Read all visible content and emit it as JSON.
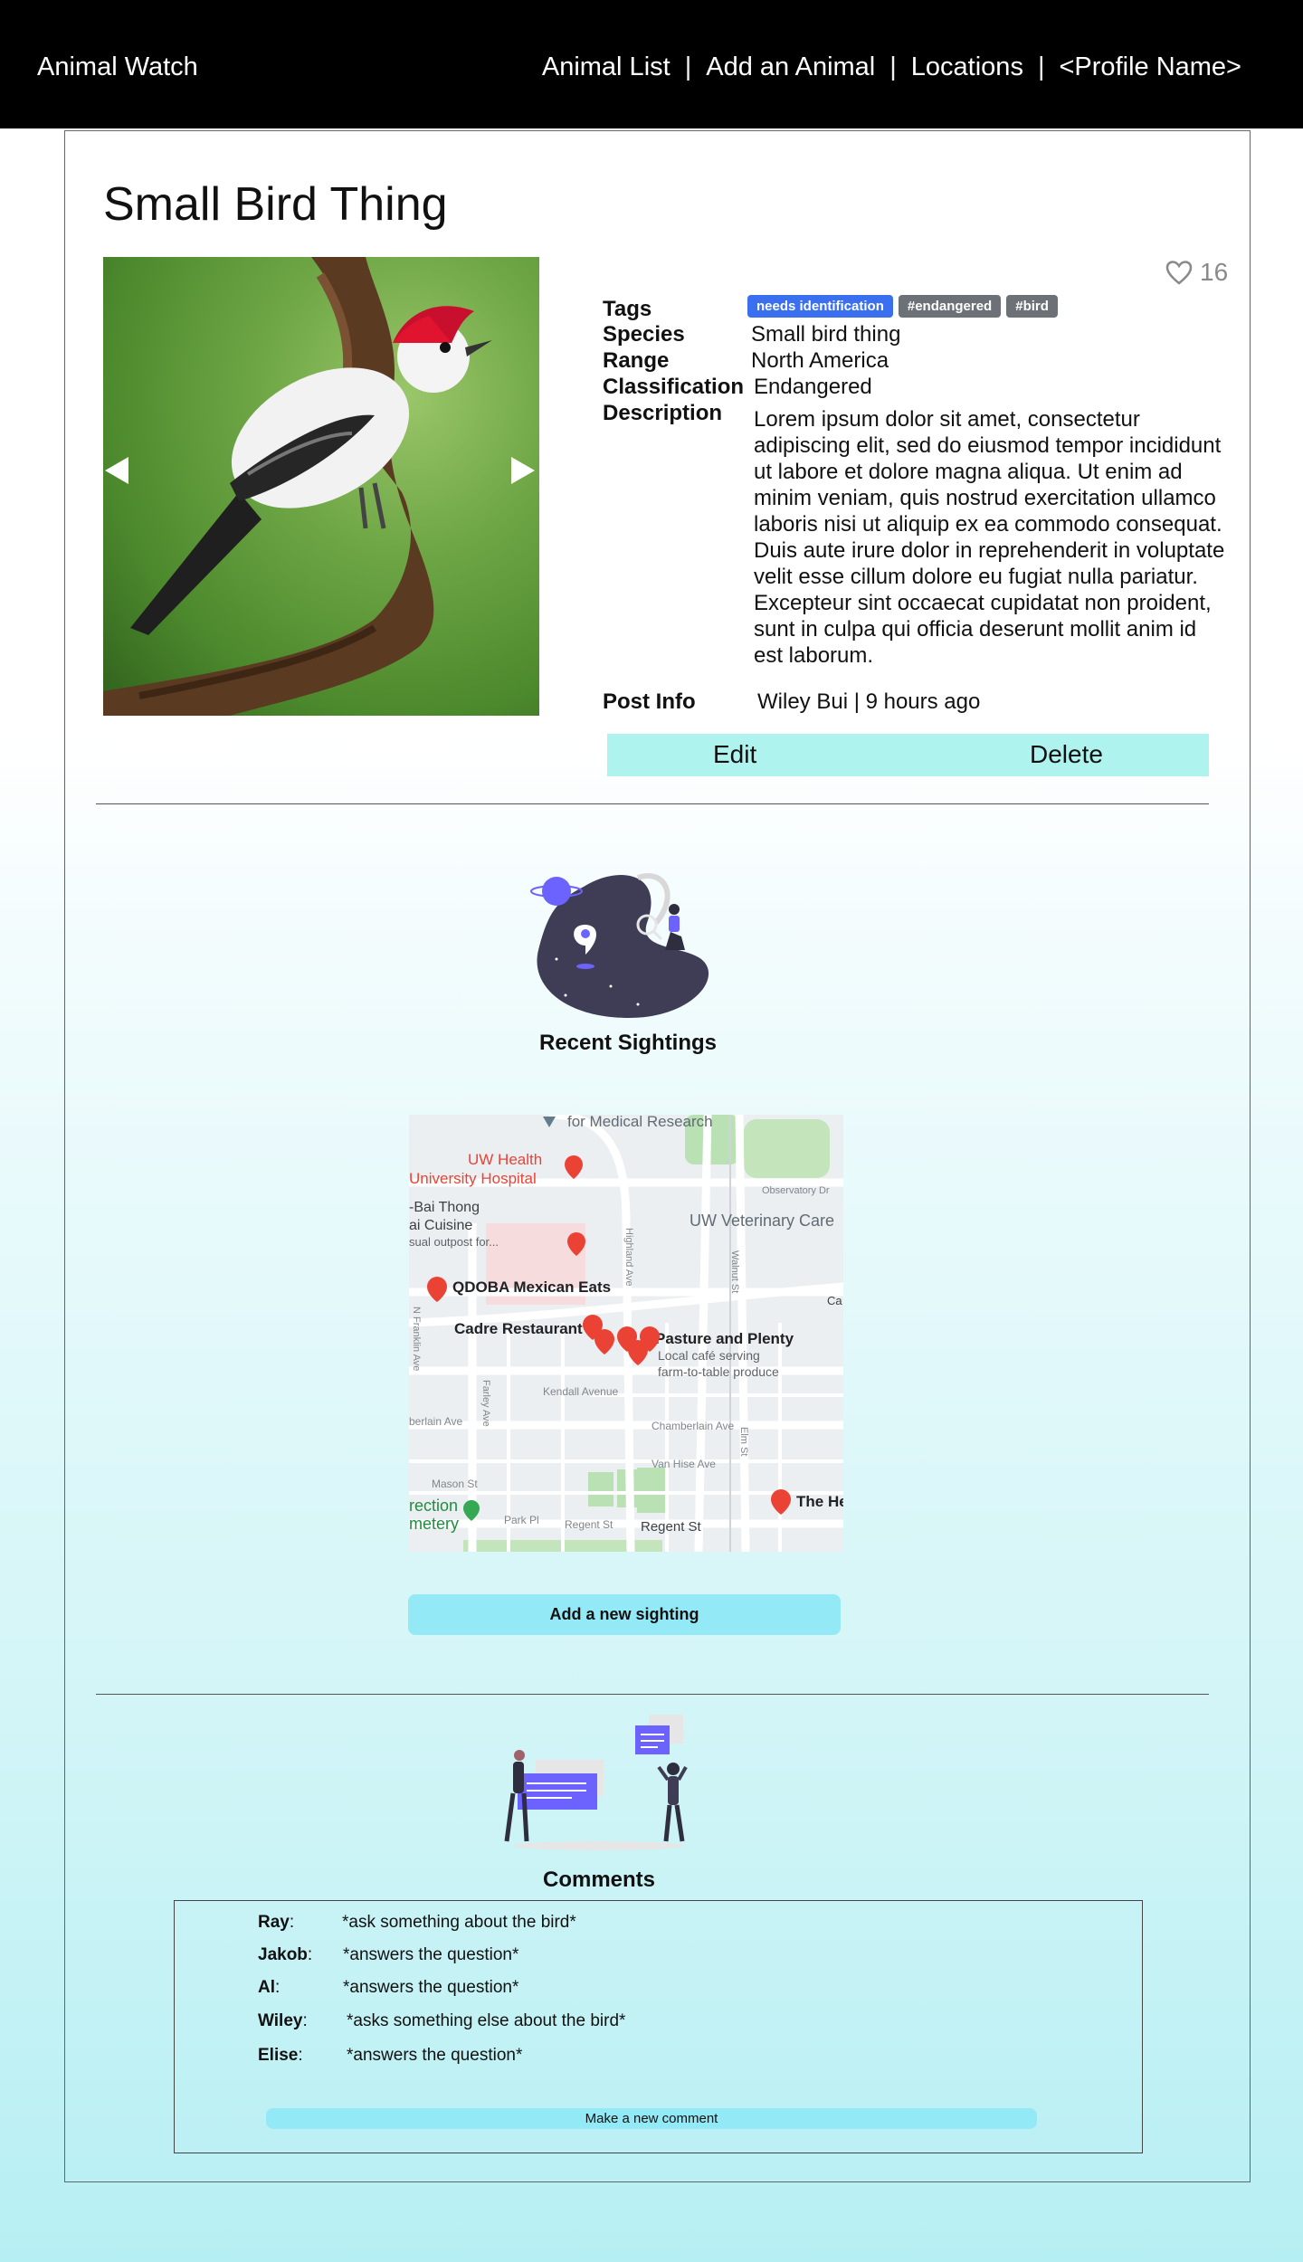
{
  "nav": {
    "brand": "Animal Watch",
    "links": [
      "Animal List",
      "Add an Animal",
      "Locations",
      "<Profile Name>"
    ],
    "separator": "|"
  },
  "animal": {
    "title": "Small Bird Thing",
    "likes": "16",
    "tags_label": "Tags",
    "tags": [
      {
        "text": "needs identification",
        "color": "#3a6ff0"
      },
      {
        "text": "#endangered",
        "color": "#6b7177"
      },
      {
        "text": "#bird",
        "color": "#6b7177"
      }
    ],
    "fields": [
      {
        "label": "Species",
        "value": "Small bird thing"
      },
      {
        "label": "Range",
        "value": "North America"
      },
      {
        "label": "Classification",
        "value": "Endangered"
      }
    ],
    "description_label": "Description",
    "description_lines": [
      "Lorem ipsum dolor sit amet, consectetur",
      "adipiscing elit, sed do eiusmod tempor incididunt",
      "ut labore et dolore magna aliqua. Ut enim ad",
      "minim veniam, quis nostrud exercitation ullamco",
      "laboris nisi ut aliquip ex ea commodo consequat.",
      "Duis aute irure dolor in reprehenderit in voluptate",
      "velit esse cillum dolore eu fugiat nulla pariatur.",
      "Excepteur sint occaecat cupidatat non proident,",
      "sunt in culpa qui officia deserunt mollit anim id",
      "est laborum."
    ],
    "post_info_label": "Post Info",
    "post_info": "Wiley Bui | 9 hours ago",
    "edit_label": "Edit",
    "delete_label": "Delete"
  },
  "sightings": {
    "title": "Recent Sightings",
    "add_button": "Add a new sighting",
    "map_labels": [
      "for Medical Research",
      "UW Health",
      "University Hospital",
      "Observatory Dr",
      "-Bai Thong",
      "ai Cuisine",
      "sual outpost for...",
      "UW Veterinary Care",
      "QDOBA Mexican Eats",
      "Cadre Restaurant",
      "Pasture and Plenty",
      "Local café serving",
      "farm-to-table produce",
      "Kendall Avenue",
      "berlain Ave",
      "Chamberlain Ave",
      "Van Hise Ave",
      "Mason St",
      "rection",
      "metery",
      "Park Pl",
      "Regent St",
      "Regent St",
      "The He",
      "Highland Ave",
      "Walnut St",
      "Farley Ave",
      "Elm St",
      "N Franklin Ave",
      "Ca"
    ]
  },
  "comments": {
    "title": "Comments",
    "items": [
      {
        "name": "Ray",
        "text": "*ask something about the bird*"
      },
      {
        "name": "Jakob",
        "text": "*answers the question*"
      },
      {
        "name": "Al",
        "text": "*answers the question*"
      },
      {
        "name": "Wiley",
        "text": "*asks something else about the bird*"
      },
      {
        "name": "Elise",
        "text": "*answers the question*"
      }
    ],
    "new_comment_button": "Make a new comment"
  },
  "colors": {
    "nav_bg": "#000000",
    "action_bar": "#aff3ee",
    "button_cyan": "#93e9f6",
    "tag_blue": "#3a6ff0",
    "tag_gray": "#6b7177",
    "illustration_purple": "#6c63ff",
    "map_pin_red": "#ea4335"
  }
}
